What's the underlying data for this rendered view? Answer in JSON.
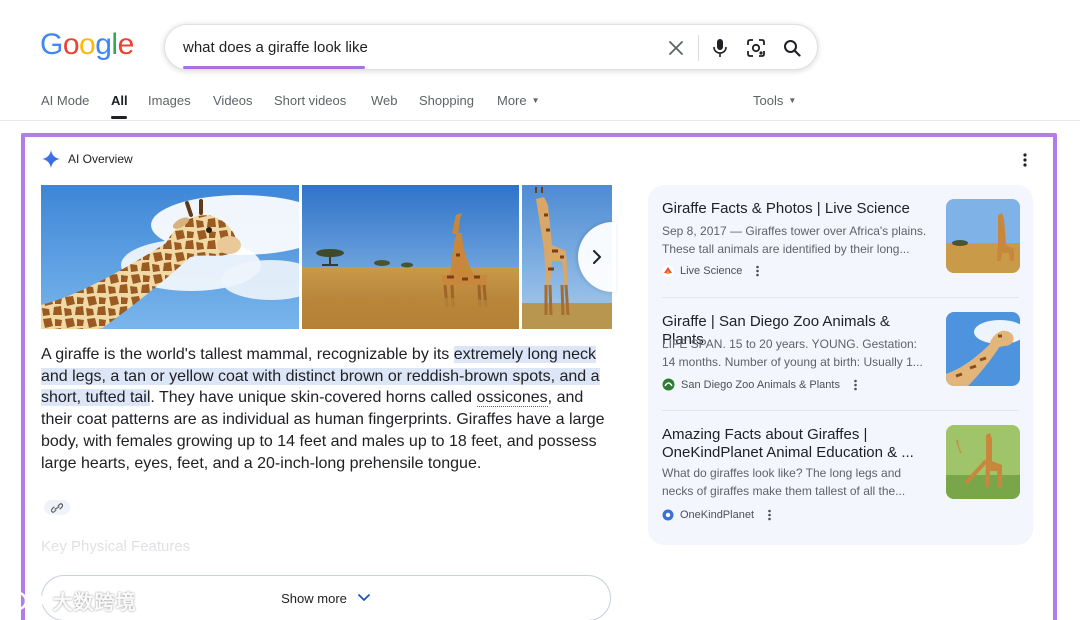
{
  "logo": {
    "letters": [
      {
        "char": "G",
        "color": "#4285F4"
      },
      {
        "char": "o",
        "color": "#EA4335"
      },
      {
        "char": "o",
        "color": "#FBBC05"
      },
      {
        "char": "g",
        "color": "#4285F4"
      },
      {
        "char": "l",
        "color": "#34A853"
      },
      {
        "char": "e",
        "color": "#EA4335"
      }
    ]
  },
  "search": {
    "query": "what does a giraffe look like",
    "icons": [
      "close-icon",
      "microphone-icon",
      "lens-icon",
      "search-icon"
    ]
  },
  "tabs": [
    {
      "label": "AI Mode",
      "active": false
    },
    {
      "label": "All",
      "active": true
    },
    {
      "label": "Images",
      "active": false
    },
    {
      "label": "Videos",
      "active": false
    },
    {
      "label": "Short videos",
      "active": false
    },
    {
      "label": "Web",
      "active": false
    },
    {
      "label": "Shopping",
      "active": false
    },
    {
      "label": "More",
      "active": false
    }
  ],
  "tools_label": "Tools",
  "ai_overview": {
    "title": "AI Overview",
    "text_parts": {
      "p1": "A giraffe is the world's tallest mammal, recognizable by its ",
      "h1": "extremely long neck and legs, a tan or yellow coat with distinct brown or reddish-brown spots, and a short, tufted tail",
      "p2": ". They have unique skin-covered horns called ",
      "link": "ossicones",
      "p3": ", and their coat patterns are as individual as human fingerprints. Giraffes have a large body, with females growing up to 14 feet and males up to 18 feet, and possess large hearts, eyes, feet, and a 20-inch-long prehensile tongue."
    },
    "next_heading": "Key Physical Features",
    "show_more": "Show more"
  },
  "sources": [
    {
      "title": "Giraffe Facts & Photos | Live Science",
      "snippet_1": "Sep 8, 2017 — Giraffes tower over Africa's plains.",
      "snippet_2": "These tall animals are identified by their long...",
      "site": "Live Science"
    },
    {
      "title": "Giraffe | San Diego Zoo Animals & Plants",
      "snippet_1": "LIFE SPAN. 15 to 20 years. YOUNG. Gestation:",
      "snippet_2": "14 months. Number of young at birth: Usually 1...",
      "site": "San Diego Zoo Animals & Plants"
    },
    {
      "title_1": "Amazing Facts about Giraffes |",
      "title_2": "OneKindPlanet Animal Education & ...",
      "snippet_1": "What do giraffes look like? The long legs and",
      "snippet_2": "necks of giraffes make them tallest of all the...",
      "site": "OneKindPlanet"
    }
  ],
  "watermark": "大数跨境",
  "colors": {
    "highlight_frame": "#b27de6",
    "highlight_text": "#dde6f7",
    "source_panel": "#f3f6fc"
  }
}
